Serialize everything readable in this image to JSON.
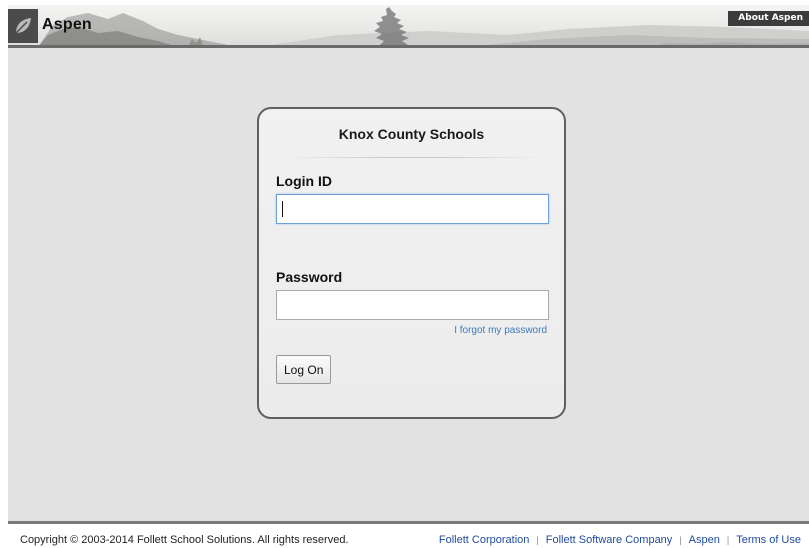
{
  "header": {
    "app_name": "Aspen",
    "about_label": "About Aspen"
  },
  "login": {
    "school_name": "Knox County Schools",
    "login_id_label": "Login ID",
    "login_id_value": "",
    "password_label": "Password",
    "password_value": "",
    "forgot_link": "I forgot my password",
    "logon_button": "Log On"
  },
  "footer": {
    "copyright": "Copyright © 2003-2014 Follett School Solutions. All rights reserved.",
    "links": [
      "Follett Corporation",
      "Follett Software Company",
      "Aspen",
      "Terms of Use"
    ],
    "separator": "|"
  },
  "colors": {
    "link": "#1f4b9c",
    "forgot_link": "#3e7ab9",
    "panel_border": "#606060",
    "background": "#e2e2e2"
  }
}
